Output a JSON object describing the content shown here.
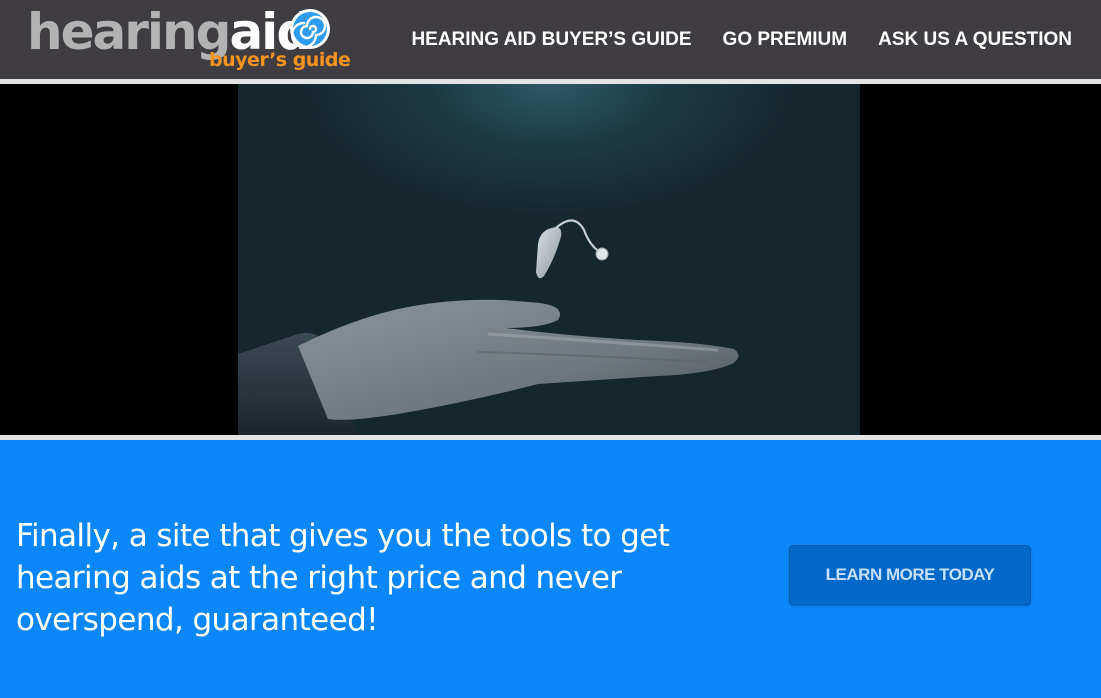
{
  "header": {
    "logo": {
      "word_gray": "hearing",
      "word_white": "aid",
      "tagline": "buyer’s guide"
    },
    "nav": [
      {
        "label": "HEARING AID BUYER’S GUIDE"
      },
      {
        "label": "GO PREMIUM"
      },
      {
        "label": "ASK US A QUESTION"
      }
    ]
  },
  "video": {
    "subject": "hand with floating hearing aid"
  },
  "hero": {
    "headline": "Finally, a site that gives you the tools to get hearing aids at the right price and never overspend, guaranteed!",
    "cta_label": "LEARN MORE TODAY"
  },
  "colors": {
    "header_bg": "#3f3d41",
    "brand_orange": "#f7931e",
    "brand_blue": "#0a87fa",
    "cta_bg": "#0068c8"
  }
}
